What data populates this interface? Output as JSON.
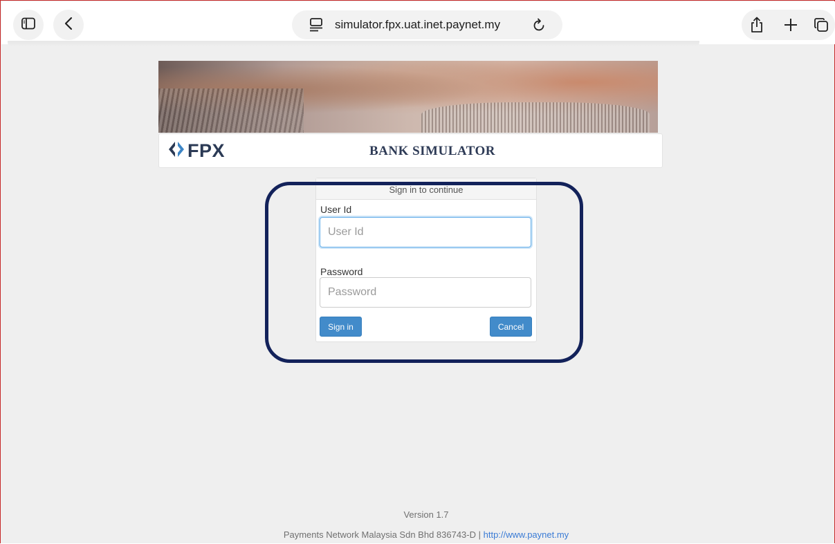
{
  "browser": {
    "url": "simulator.fpx.uat.inet.paynet.my",
    "icons": {
      "sidebar": "sidebar-icon",
      "back": "chevron-left-icon",
      "page_menu": "page-menu-icon",
      "reload": "reload-icon",
      "share": "share-icon",
      "new_tab": "plus-icon",
      "tabs": "tabs-icon"
    }
  },
  "header": {
    "logo_text": "FPX",
    "title": "BANK SIMULATOR"
  },
  "login": {
    "heading": "Sign in to continue",
    "user_id_label": "User Id",
    "user_id_placeholder": "User Id",
    "user_id_value": "",
    "password_label": "Password",
    "password_placeholder": "Password",
    "password_value": "",
    "sign_in_label": "Sign in",
    "cancel_label": "Cancel"
  },
  "footer": {
    "version": "Version 1.7",
    "company": "Payments Network Malaysia Sdn Bhd 836743-D | ",
    "link": "http://www.paynet.my"
  },
  "colors": {
    "accent_button": "#428bca",
    "highlight_outline": "#13225a",
    "logo_text": "#2b3a55",
    "page_background": "#efefef"
  }
}
